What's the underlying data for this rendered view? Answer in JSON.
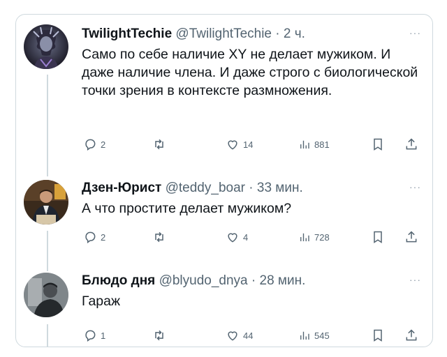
{
  "tweets": [
    {
      "name": "TwilightTechie",
      "handle": "@TwilightTechie",
      "dot": "·",
      "time": "2 ч.",
      "more": "···",
      "text": "Само по себе наличие XY не делает мужиком. И даже наличие члена. И даже строго с биологической точки зрения в контексте размножения.",
      "replies": "2",
      "retweets": "",
      "likes": "14",
      "views": "881"
    },
    {
      "name": "Дзен-Юрист",
      "handle": "@teddy_boar",
      "dot": "·",
      "time": "33 мин.",
      "more": "···",
      "text": "А что простите делает мужиком?",
      "replies": "2",
      "retweets": "",
      "likes": "4",
      "views": "728"
    },
    {
      "name": "Блюдо дня",
      "handle": "@blyudo_dnya",
      "dot": "·",
      "time": "28 мин.",
      "more": "···",
      "text": "Гараж",
      "replies": "1",
      "retweets": "",
      "likes": "44",
      "views": "545"
    }
  ],
  "colors": {
    "text": "#0f1419",
    "secondary": "#536471",
    "border": "#cfd9de"
  }
}
